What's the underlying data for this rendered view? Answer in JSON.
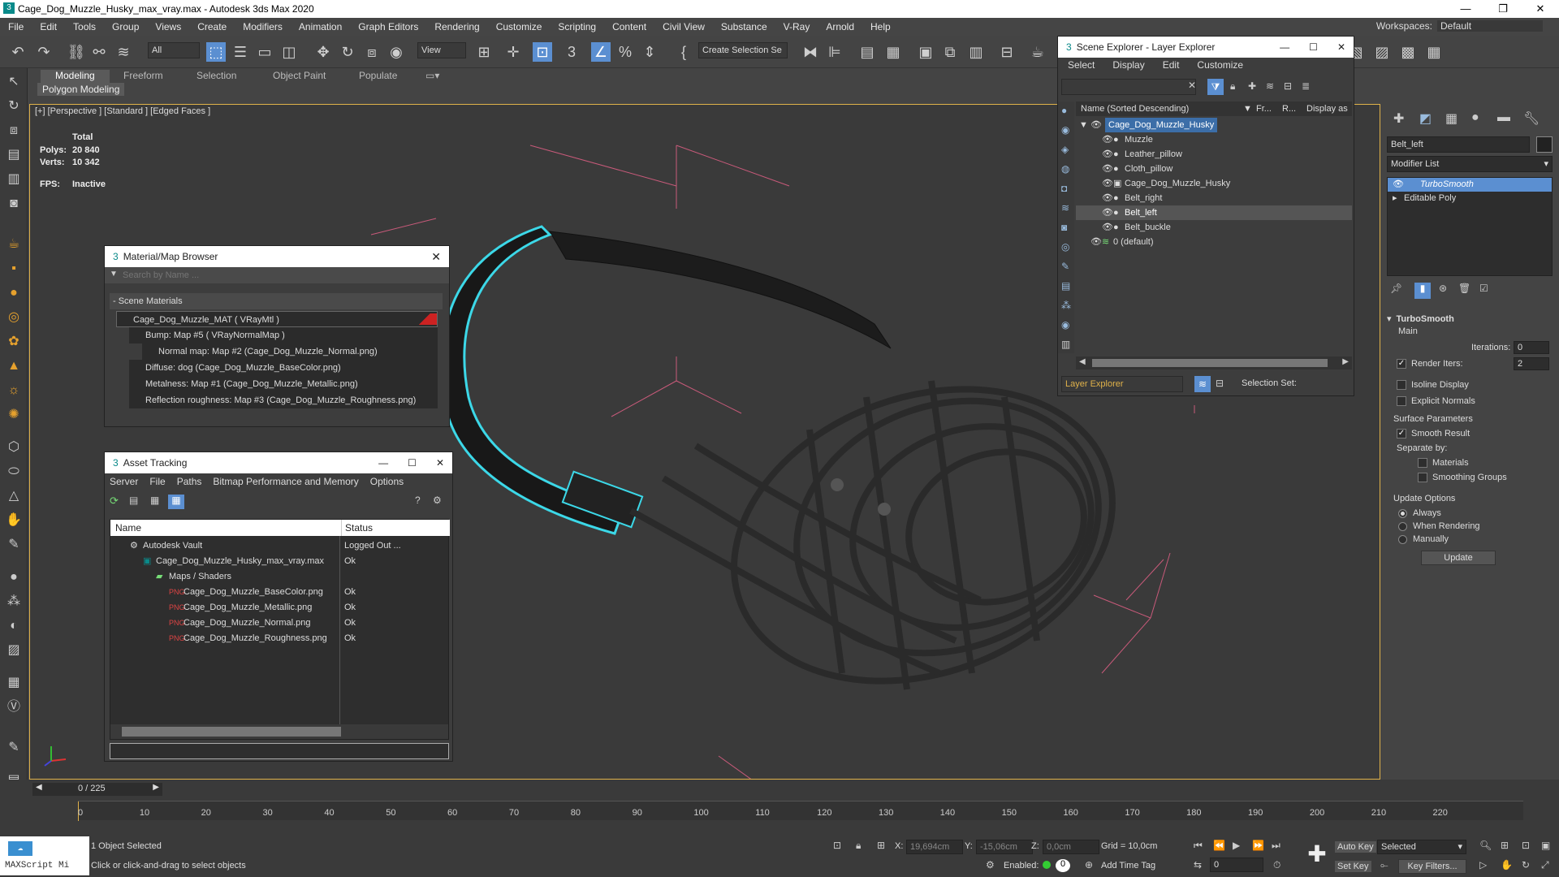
{
  "window": {
    "title": "Cage_Dog_Muzzle_Husky_max_vray.max - Autodesk 3ds Max 2020"
  },
  "menu": [
    "File",
    "Edit",
    "Tools",
    "Group",
    "Views",
    "Create",
    "Modifiers",
    "Animation",
    "Graph Editors",
    "Rendering",
    "Customize",
    "Scripting",
    "Content",
    "Civil View",
    "Substance",
    "V-Ray",
    "Arnold",
    "Help"
  ],
  "workspaces": {
    "label": "Workspaces:",
    "value": "Default"
  },
  "toolbar": {
    "filter": "All",
    "view": "View",
    "selection_set": "Create Selection Se"
  },
  "ribbon": {
    "tabs": [
      "Modeling",
      "Freeform",
      "Selection",
      "Object Paint",
      "Populate"
    ],
    "sub": "Polygon Modeling"
  },
  "viewport": {
    "label": "[+] [Perspective ] [Standard ] [Edged Faces ]",
    "total": "Total",
    "polys_label": "Polys:",
    "polys": "20 840",
    "verts_label": "Verts:",
    "verts": "10 342",
    "fps_label": "FPS:",
    "fps": "Inactive"
  },
  "material_browser": {
    "title": "Material/Map Browser",
    "search_placeholder": "Search by Name ...",
    "section": "- Scene Materials",
    "items": [
      "Cage_Dog_Muzzle_MAT ( VRayMtl )",
      "Bump: Map #5 ( VRayNormalMap )",
      "Normal map: Map #2 (Cage_Dog_Muzzle_Normal.png)",
      "Diffuse: dog (Cage_Dog_Muzzle_BaseColor.png)",
      "Metalness: Map #1 (Cage_Dog_Muzzle_Metallic.png)",
      "Reflection roughness: Map #3 (Cage_Dog_Muzzle_Roughness.png)"
    ]
  },
  "asset_tracking": {
    "title": "Asset Tracking",
    "menu": [
      "Server",
      "File",
      "Paths",
      "Bitmap Performance and Memory",
      "Options"
    ],
    "col_name": "Name",
    "col_status": "Status",
    "rows": [
      {
        "name": "Autodesk Vault",
        "status": "Logged Out ..."
      },
      {
        "name": "Cage_Dog_Muzzle_Husky_max_vray.max",
        "status": "Ok"
      },
      {
        "name": "Maps / Shaders",
        "status": ""
      },
      {
        "name": "Cage_Dog_Muzzle_BaseColor.png",
        "status": "Ok"
      },
      {
        "name": "Cage_Dog_Muzzle_Metallic.png",
        "status": "Ok"
      },
      {
        "name": "Cage_Dog_Muzzle_Normal.png",
        "status": "Ok"
      },
      {
        "name": "Cage_Dog_Muzzle_Roughness.png",
        "status": "Ok"
      }
    ]
  },
  "scene_explorer": {
    "title": "Scene Explorer - Layer Explorer",
    "menu": [
      "Select",
      "Display",
      "Edit",
      "Customize"
    ],
    "col_name": "Name (Sorted Descending)",
    "col_fr": "Fr...",
    "col_r": "R...",
    "col_disp": "Display as Bo",
    "items": [
      "Cage_Dog_Muzzle_Husky",
      "Muzzle",
      "Leather_pillow",
      "Cloth_pillow",
      "Cage_Dog_Muzzle_Husky",
      "Belt_right",
      "Belt_left",
      "Belt_buckle",
      "0 (default)"
    ],
    "footer_left": "Layer Explorer",
    "footer_right": "Selection Set:"
  },
  "command_panel": {
    "object_name": "Belt_left",
    "modifier_list": "Modifier List",
    "stack": [
      "TurboSmooth",
      "Editable Poly"
    ],
    "rollout": "TurboSmooth",
    "main": "Main",
    "iterations_label": "Iterations:",
    "iterations": "0",
    "render_iters_label": "Render Iters:",
    "render_iters": "2",
    "isoline": "Isoline Display",
    "explicit": "Explicit Normals",
    "surface": "Surface Parameters",
    "smooth": "Smooth Result",
    "separate": "Separate by:",
    "materials": "Materials",
    "smoothing_groups": "Smoothing Groups",
    "update_options": "Update Options",
    "always": "Always",
    "when_rendering": "When Rendering",
    "manually": "Manually",
    "update": "Update"
  },
  "timeline": {
    "frame": "0 / 225",
    "ticks": [
      "0",
      "10",
      "20",
      "30",
      "40",
      "50",
      "60",
      "70",
      "80",
      "90",
      "100",
      "110",
      "120",
      "130",
      "140",
      "150",
      "160",
      "170",
      "180",
      "190",
      "200",
      "210",
      "220"
    ]
  },
  "status": {
    "maxscript": "MAXScript Mi",
    "selected": "1 Object Selected",
    "hint": "Click or click-and-drag to select objects",
    "x_label": "X:",
    "x": "19,694cm",
    "y_label": "Y:",
    "y": "-15,06cm",
    "z_label": "Z:",
    "z": "0,0cm",
    "grid": "Grid = 10,0cm",
    "enabled": "Enabled:",
    "add_time_tag": "Add Time Tag",
    "auto_key": "Auto Key",
    "set_key": "Set Key",
    "selected_dd": "Selected",
    "key_filters": "Key Filters...",
    "frame_num": "0"
  },
  "colors": {
    "accent": "#5b8fd1",
    "viewport_border": "#e0b24a",
    "selection": "#3cd8e8"
  }
}
